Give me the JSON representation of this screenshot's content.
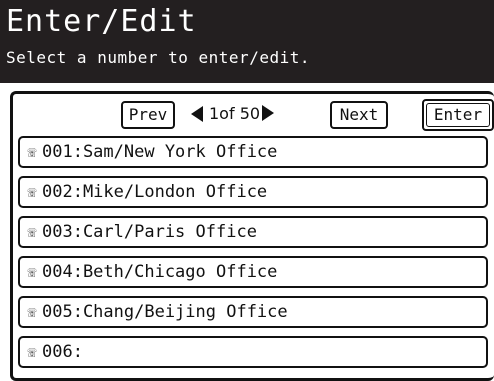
{
  "header": {
    "title": "Enter/Edit",
    "subtitle": "Select a number to enter/edit."
  },
  "nav": {
    "prev_label": "Prev",
    "page_indicator": "1of 50",
    "next_label": "Next",
    "enter_label": "Enter"
  },
  "entries": [
    {
      "icon": "phone-icon",
      "text": "001:Sam/New York Office"
    },
    {
      "icon": "phone-icon",
      "text": "002:Mike/London Office"
    },
    {
      "icon": "phone-icon",
      "text": "003:Carl/Paris Office"
    },
    {
      "icon": "phone-icon",
      "text": "004:Beth/Chicago Office"
    },
    {
      "icon": "phone-icon",
      "text": "005:Chang/Beijing Office"
    },
    {
      "icon": "phone-icon",
      "text": "006:"
    }
  ]
}
